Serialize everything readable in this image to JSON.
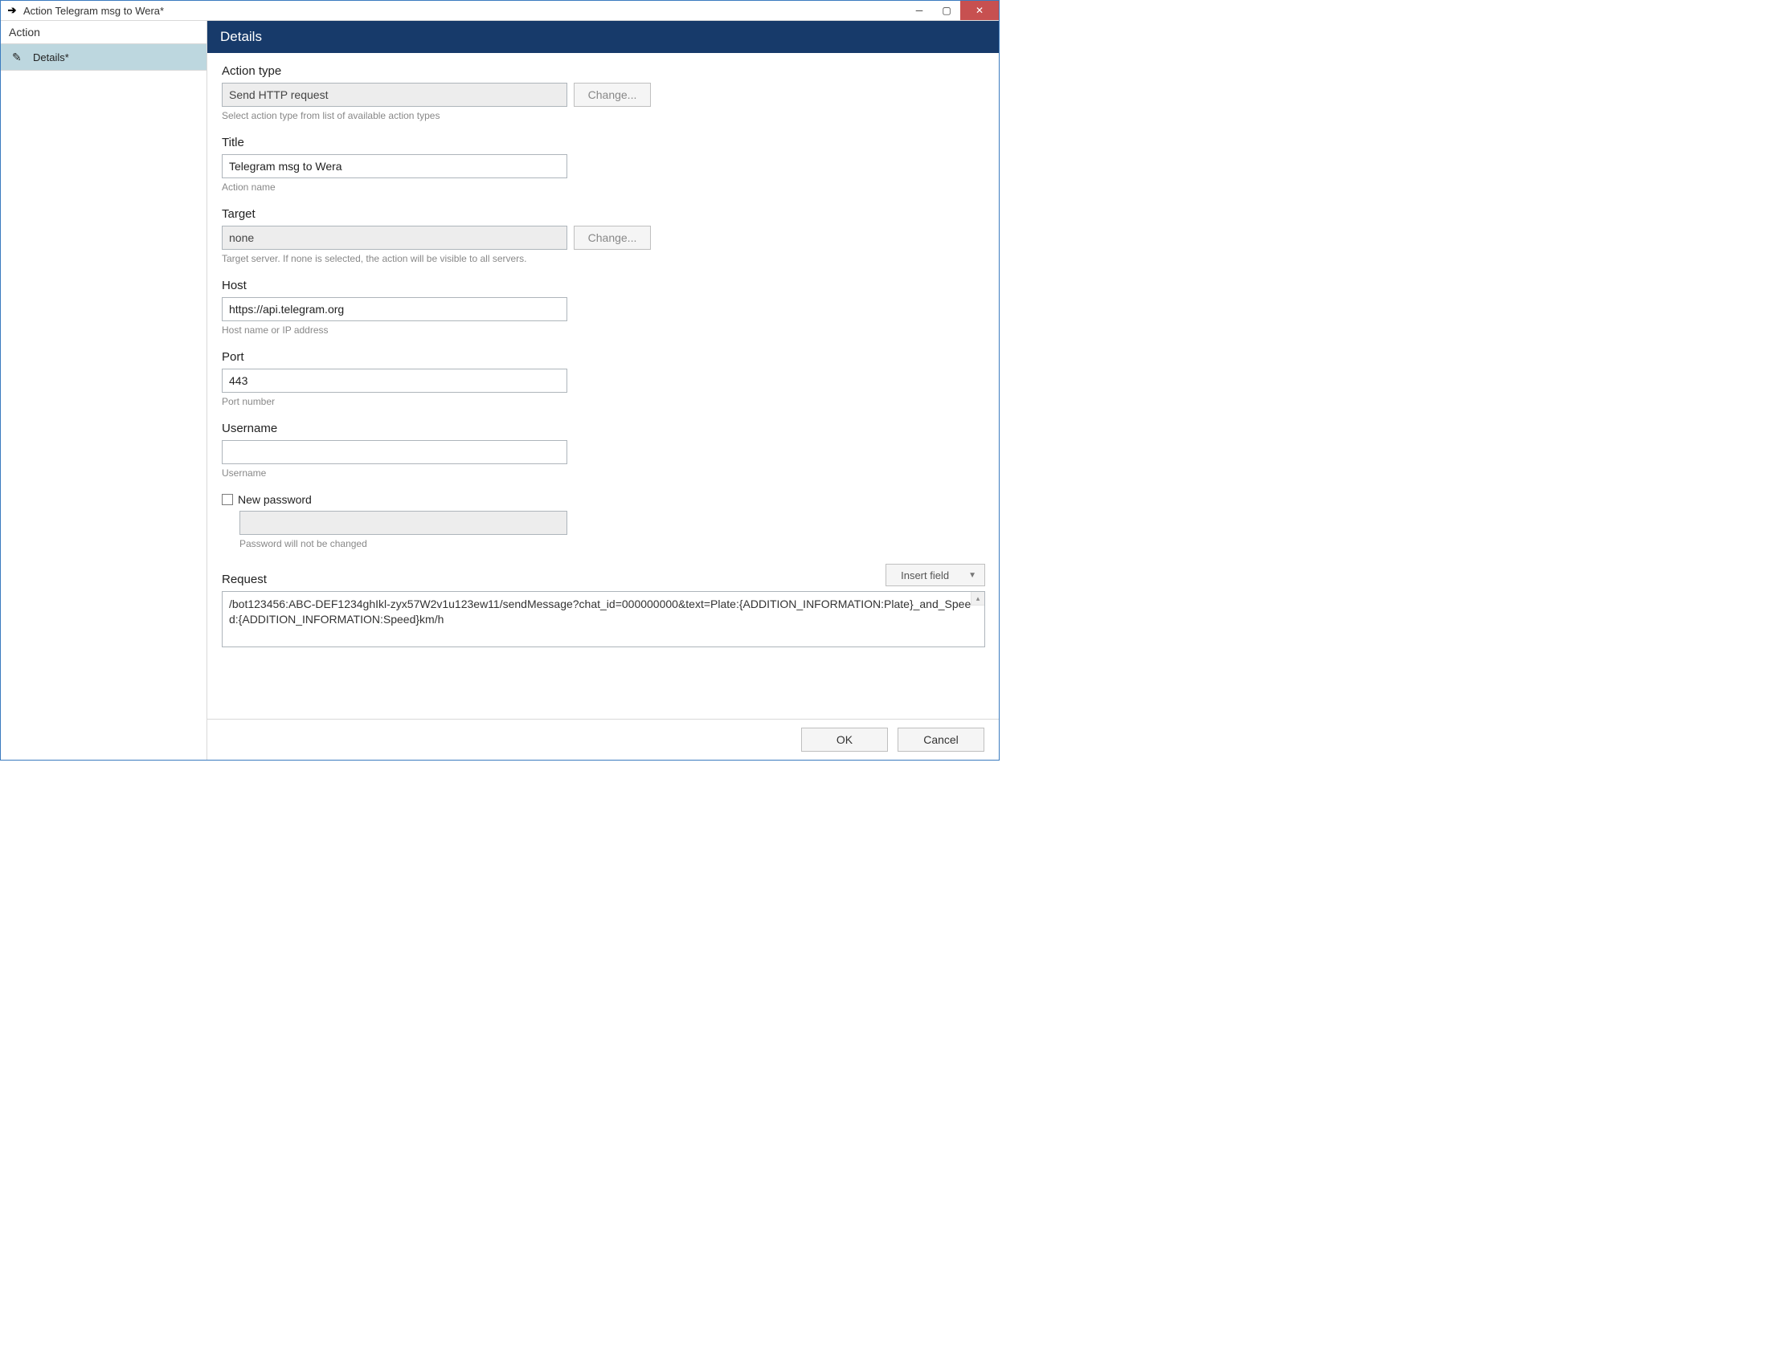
{
  "window": {
    "title": "Action Telegram msg to Wera*"
  },
  "sidebar": {
    "header": "Action",
    "item_label": "Details*"
  },
  "details": {
    "header": "Details",
    "action_type": {
      "label": "Action type",
      "value": "Send HTTP request",
      "helper": "Select action type from list of available action types",
      "change_btn": "Change..."
    },
    "title_field": {
      "label": "Title",
      "value": "Telegram msg to Wera",
      "helper": "Action name"
    },
    "target": {
      "label": "Target",
      "value": "none",
      "helper": "Target server. If none is selected, the action will be visible to all servers.",
      "change_btn": "Change..."
    },
    "host": {
      "label": "Host",
      "value": "https://api.telegram.org",
      "helper": "Host name or IP address"
    },
    "port": {
      "label": "Port",
      "value": "443",
      "helper": "Port number"
    },
    "username": {
      "label": "Username",
      "value": "",
      "helper": "Username"
    },
    "password": {
      "checkbox_label": "New password",
      "value": "",
      "helper": "Password will not be changed"
    },
    "request": {
      "label": "Request",
      "insert_field_btn": "Insert field",
      "value": "/bot123456:ABC-DEF1234ghIkl-zyx57W2v1u123ew11/sendMessage?chat_id=000000000&text=Plate:{ADDITION_INFORMATION:Plate}_and_Speed:{ADDITION_INFORMATION:Speed}km/h"
    }
  },
  "buttons": {
    "ok": "OK",
    "cancel": "Cancel"
  }
}
